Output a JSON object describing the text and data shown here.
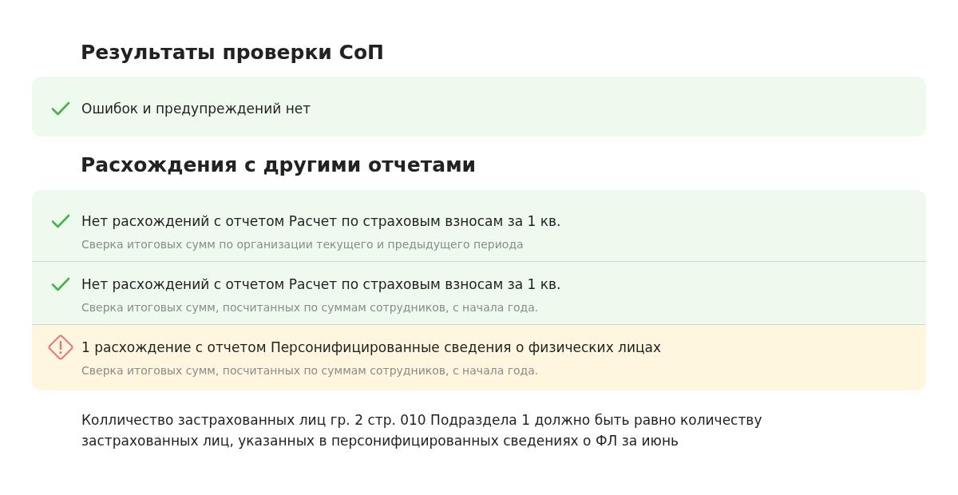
{
  "sections": [
    {
      "title": "Результаты проверки СоП",
      "items": [
        {
          "kind": "ok",
          "title": "Ошибок и предупреждений нет"
        }
      ]
    },
    {
      "title": "Расхождения с другими отчетами",
      "items": [
        {
          "kind": "ok",
          "title": "Нет расхождений с отчетом Расчет по страховым взносам за 1 кв.",
          "description": "Сверка итоговых сумм по организации текущего и предыдущего периода"
        },
        {
          "kind": "ok",
          "title": "Нет расхождений с отчетом Расчет по страховым взносам за 1 кв.",
          "description": "Сверка итоговых сумм, посчитанных по суммам сотрудников, с начала года."
        },
        {
          "kind": "warning",
          "title": "1 расхождение с отчетом Персонифицированные сведения о физических лицах",
          "description": "Сверка итоговых сумм, посчитанных по суммам сотрудников, с начала года."
        }
      ]
    }
  ],
  "note": "Колличество застрахованных лиц гр. 2 стр. 010 Подраздела 1 должно быть равно количеству застрахованных лиц, указанных в персонифицированных сведениях о ФЛ за июнь"
}
